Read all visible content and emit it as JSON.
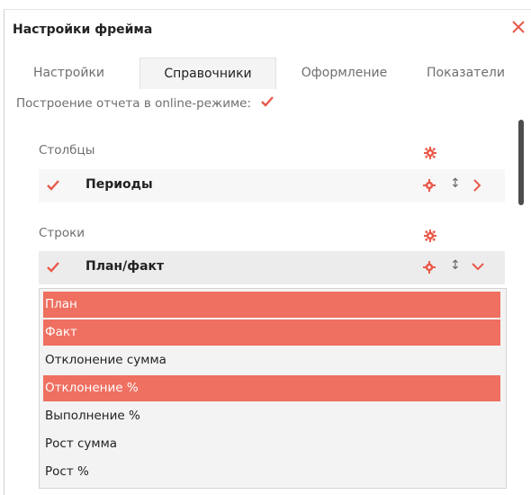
{
  "dialog": {
    "title": "Настройки фрейма",
    "close_icon": "close-x-icon",
    "accent_color": "#e8594a"
  },
  "tabs": [
    {
      "label": "Настройки",
      "active": false
    },
    {
      "label": "Справочники",
      "active": true
    },
    {
      "label": "Оформление",
      "active": false
    },
    {
      "label": "Показатели",
      "active": false
    }
  ],
  "online": {
    "label": "Построение отчета в online-режиме:",
    "checked": true
  },
  "columns": {
    "label": "Столбцы",
    "rows": [
      {
        "label": "Периоды",
        "checked": true,
        "expanded": false
      }
    ]
  },
  "rows_section": {
    "label": "Строки",
    "rows": [
      {
        "label": "План/факт",
        "checked": true,
        "expanded": true
      }
    ]
  },
  "list": {
    "items": [
      {
        "label": "План",
        "selected": true
      },
      {
        "label": "Факт",
        "selected": true
      },
      {
        "label": "Отклонение сумма",
        "selected": false
      },
      {
        "label": "Отклонение %",
        "selected": true
      },
      {
        "label": "Выполнение %",
        "selected": false
      },
      {
        "label": "Рост сумма",
        "selected": false
      },
      {
        "label": "Рост %",
        "selected": false
      }
    ],
    "selected_color": "#ef6f60"
  }
}
